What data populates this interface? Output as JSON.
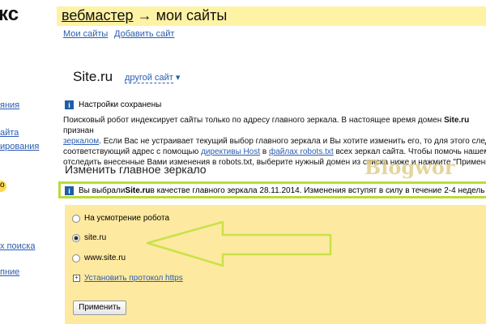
{
  "sidebar": {
    "logo_fragment": "кс",
    "links": [
      "яния",
      "айта",
      "ирования",
      "о",
      "х поиска",
      "пние"
    ]
  },
  "header": {
    "crumb": "вебмастер",
    "arrow": "→",
    "title": "мои сайты"
  },
  "subnav": {
    "my_sites": "Мои сайты",
    "add_site": "Добавить сайт"
  },
  "site": {
    "name": "Site.ru",
    "other_site": "другой сайт",
    "other_site_caret": "▾"
  },
  "notice_saved": "Настройки сохранены",
  "description": {
    "p1": "Поисковый робот индексирует сайты только по адресу главного зеркала. В настоящее время домен ",
    "domain": "Site.ru",
    "p1b": " признан",
    "link_mirror": "зеркалом",
    "p2": ". Если Вас не устраивает текущий выбор главного зеркала и Вы хотите изменить его, то для этого следу",
    "p3": "соответствующий адрес с помощью ",
    "link_host": "директивы Host",
    "p4": " в ",
    "link_robots": "файлах robots.txt",
    "p5": " всех зеркал сайта. Чтобы помочь нашем",
    "p6": "отследить внесенные Вами изменения в robots.txt, выберите нужный домен из списка ниже и нажмите \"Применит"
  },
  "section_title": "Изменить главное зеркало",
  "watermark": "Blogwor",
  "notice_selected": {
    "before": "Вы выбрали ",
    "domain": "Site.ru",
    "after": " в качестве главного зеркала 28.11.2014. Изменения вступят в силу в течение 2-4 недель"
  },
  "options": [
    {
      "label": "На усмотрение робота",
      "checked": false
    },
    {
      "label": "site.ru",
      "checked": true
    },
    {
      "label": "www.site.ru",
      "checked": false
    }
  ],
  "https_toggle": "Установить протокол https",
  "apply_button": "Применить",
  "colors": {
    "header_bg": "#fef3a4",
    "panel_bg": "#fde9a0",
    "link": "#2a5db0",
    "highlight": "#b9dc3a",
    "arrow": "#c8e24a"
  }
}
